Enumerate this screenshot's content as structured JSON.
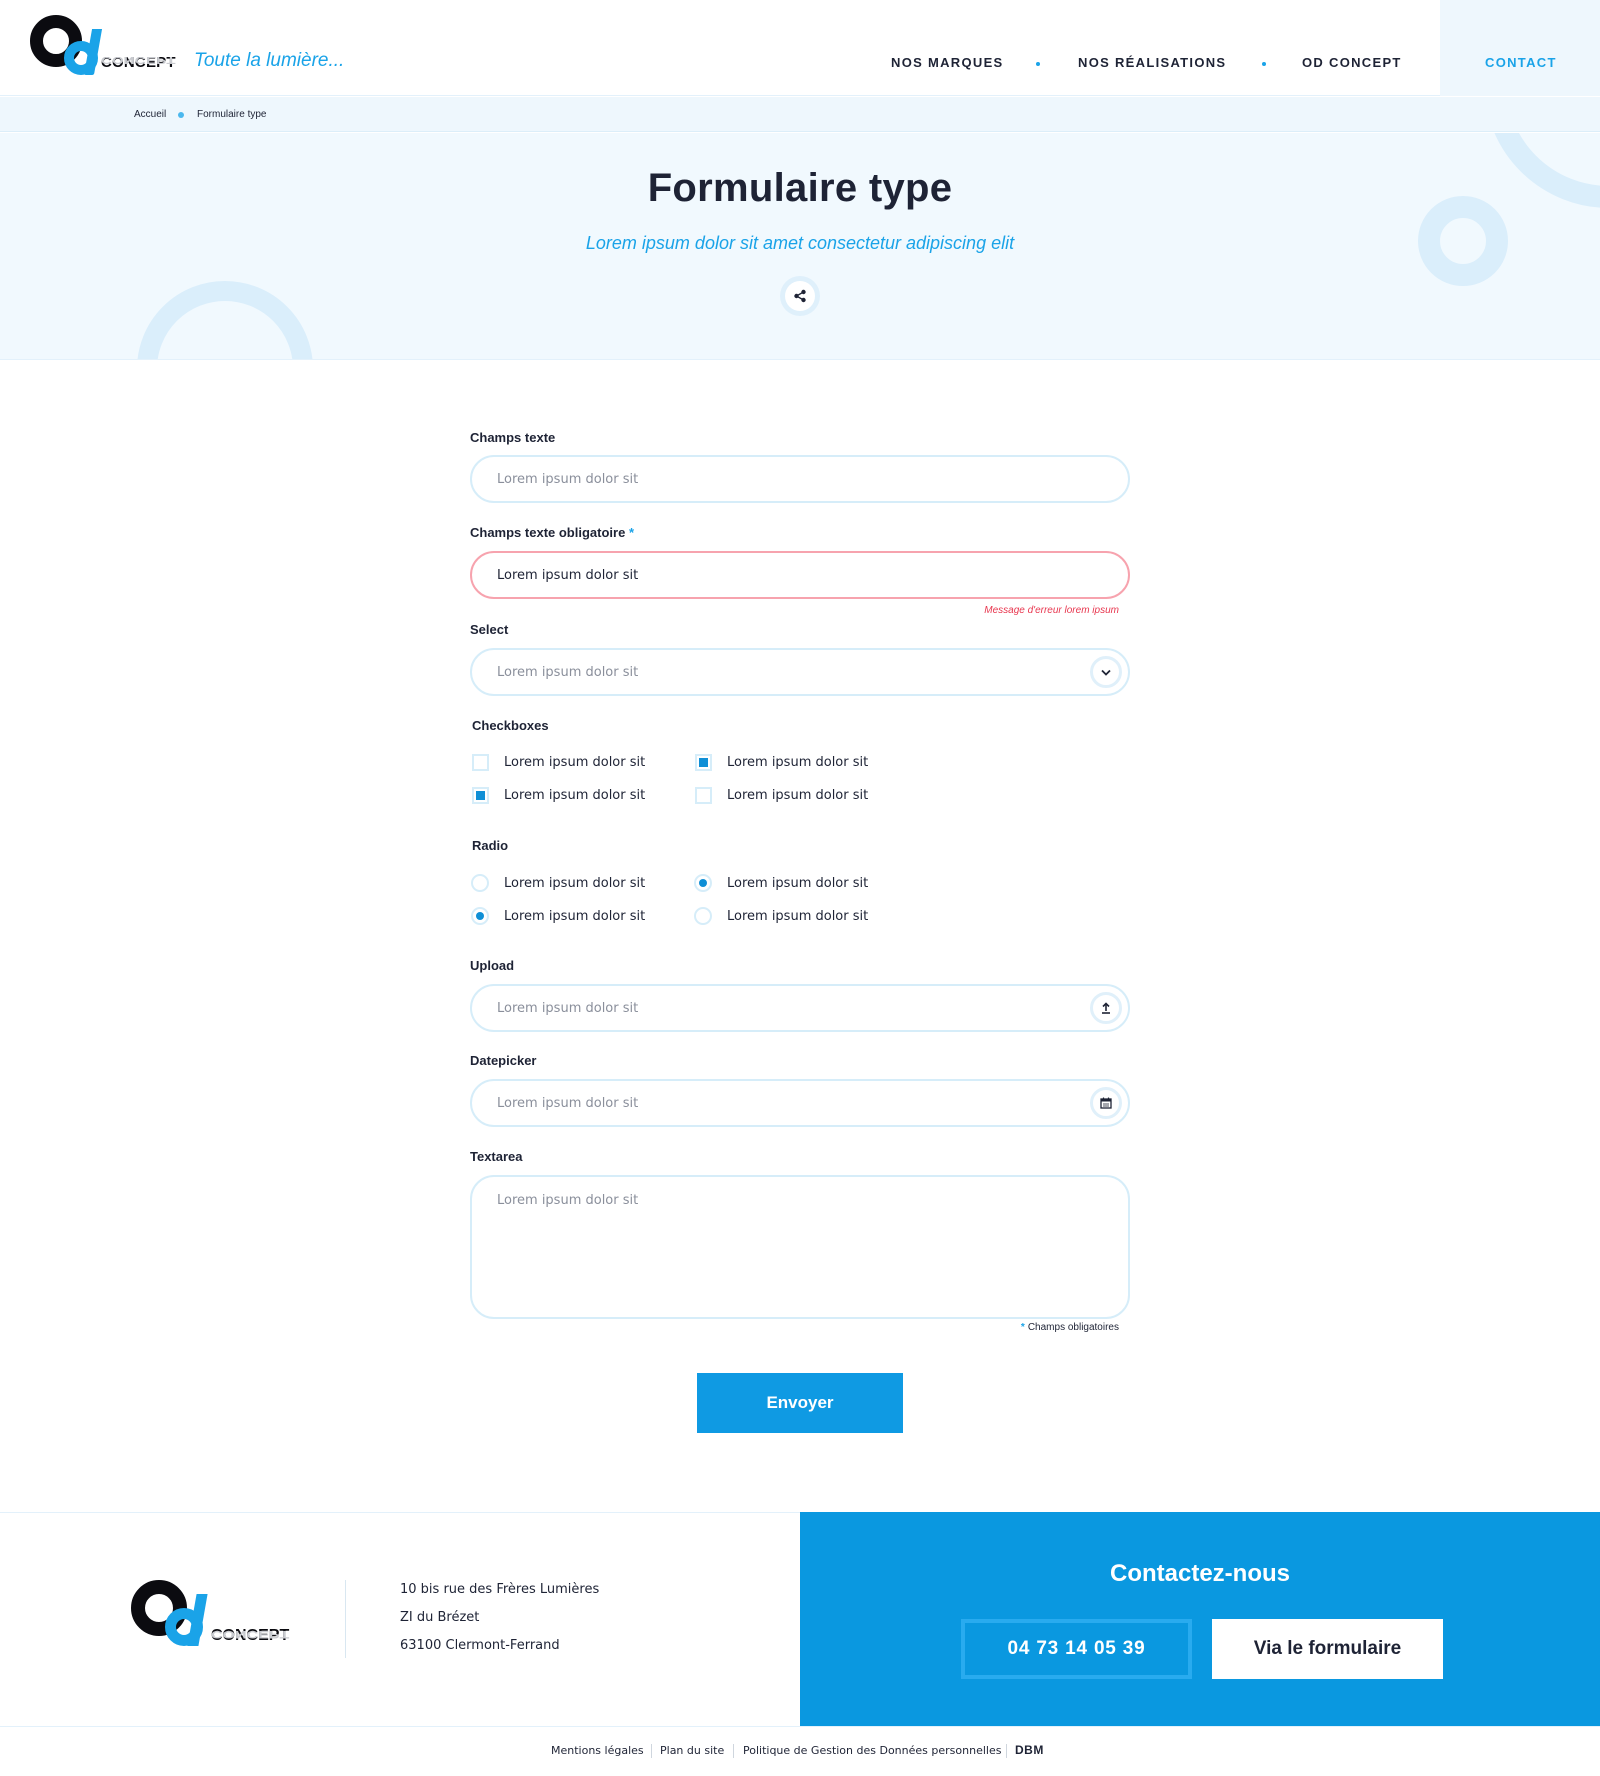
{
  "brand": {
    "logo_word": "CONCEPT",
    "tagline": "Toute la lumière...",
    "accent_color": "#1aa3e8"
  },
  "nav": {
    "items": [
      "NOS MARQUES",
      "NOS RÉALISATIONS",
      "OD CONCEPT"
    ],
    "contact": "CONTACT"
  },
  "breadcrumb": {
    "home": "Accueil",
    "current": "Formulaire type"
  },
  "hero": {
    "title": "Formulaire type",
    "subtitle": "Lorem ipsum dolor sit amet consectetur adipiscing elit",
    "share_icon": "share-icon"
  },
  "form": {
    "text_field": {
      "label": "Champs texte",
      "placeholder": "Lorem ipsum dolor sit"
    },
    "required_field": {
      "label": "Champs texte obligatoire",
      "required_mark": "*",
      "value": "Lorem ipsum dolor sit",
      "error": "Message d'erreur lorem ipsum"
    },
    "select": {
      "label": "Select",
      "value": "Lorem ipsum dolor sit",
      "icon": "chevron-down-icon"
    },
    "checkboxes": {
      "label": "Checkboxes",
      "options": [
        {
          "text": "Lorem ipsum dolor sit",
          "checked": false
        },
        {
          "text": "Lorem ipsum dolor sit",
          "checked": true
        },
        {
          "text": "Lorem ipsum dolor sit",
          "checked": true
        },
        {
          "text": "Lorem ipsum dolor sit",
          "checked": false
        }
      ]
    },
    "radio": {
      "label": "Radio",
      "options": [
        {
          "text": "Lorem ipsum dolor sit",
          "checked": false
        },
        {
          "text": "Lorem ipsum dolor sit",
          "checked": true
        },
        {
          "text": "Lorem ipsum dolor sit",
          "checked": true
        },
        {
          "text": "Lorem ipsum dolor sit",
          "checked": false
        }
      ]
    },
    "upload": {
      "label": "Upload",
      "placeholder": "Lorem ipsum dolor sit",
      "icon": "upload-icon"
    },
    "datepicker": {
      "label": "Datepicker",
      "placeholder": "Lorem ipsum dolor sit",
      "icon": "calendar-icon"
    },
    "textarea": {
      "label": "Textarea",
      "placeholder": "Lorem ipsum dolor sit"
    },
    "required_note": {
      "star": "*",
      "text": "Champs obligatoires"
    },
    "submit": "Envoyer"
  },
  "footer": {
    "logo_word": "CONCEPT",
    "address": [
      "10 bis rue des Frères Lumières",
      "ZI du Brézet",
      "63100 Clermont-Ferrand"
    ],
    "cta": {
      "title": "Contactez-nous",
      "phone": "04 73 14 05 39",
      "form_button": "Via le formulaire"
    },
    "legal": [
      "Mentions légales",
      "Plan du site",
      "Politique de Gestion des Données personnelles"
    ],
    "agency": "DBM"
  }
}
